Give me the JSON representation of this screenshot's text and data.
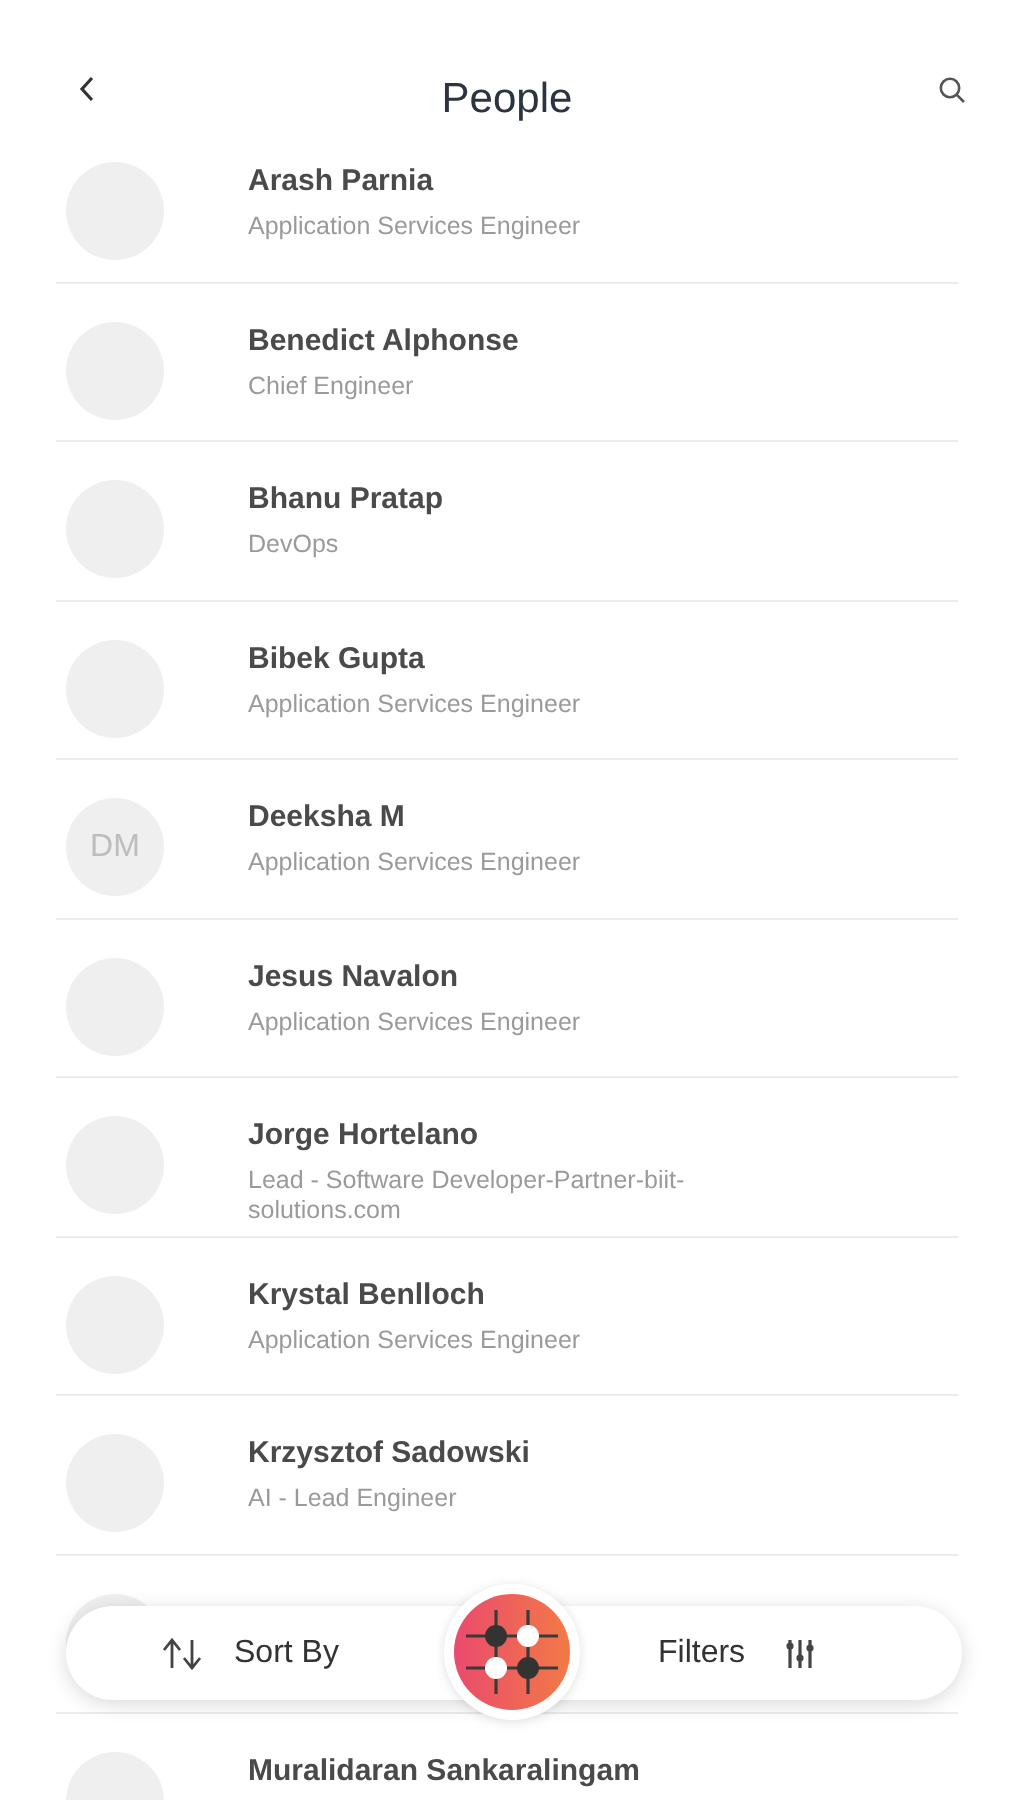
{
  "header": {
    "title": "People"
  },
  "people": [
    {
      "name": "Arash Parnia",
      "role": "Application Services Engineer"
    },
    {
      "name": "Benedict Alphonse",
      "role": "Chief Engineer"
    },
    {
      "name": "Bhanu Pratap",
      "role": "DevOps"
    },
    {
      "name": "Bibek Gupta",
      "role": "Application Services Engineer"
    },
    {
      "name": "Deeksha M",
      "role": "Application Services Engineer",
      "initials": "DM"
    },
    {
      "name": "Jesus Navalon",
      "role": "Application Services Engineer"
    },
    {
      "name": "Jorge Hortelano",
      "role": "Lead - Software Developer-Partner-biit-solutions.com"
    },
    {
      "name": "Krystal Benlloch",
      "role": "Application Services Engineer"
    },
    {
      "name": "Krzysztof Sadowski",
      "role": "AI - Lead Engineer"
    },
    {
      "hidden": true
    },
    {
      "name": "Muralidaran Sankaralingam"
    }
  ],
  "bottom_bar": {
    "sort_label": "Sort By",
    "filters_label": "Filters"
  }
}
